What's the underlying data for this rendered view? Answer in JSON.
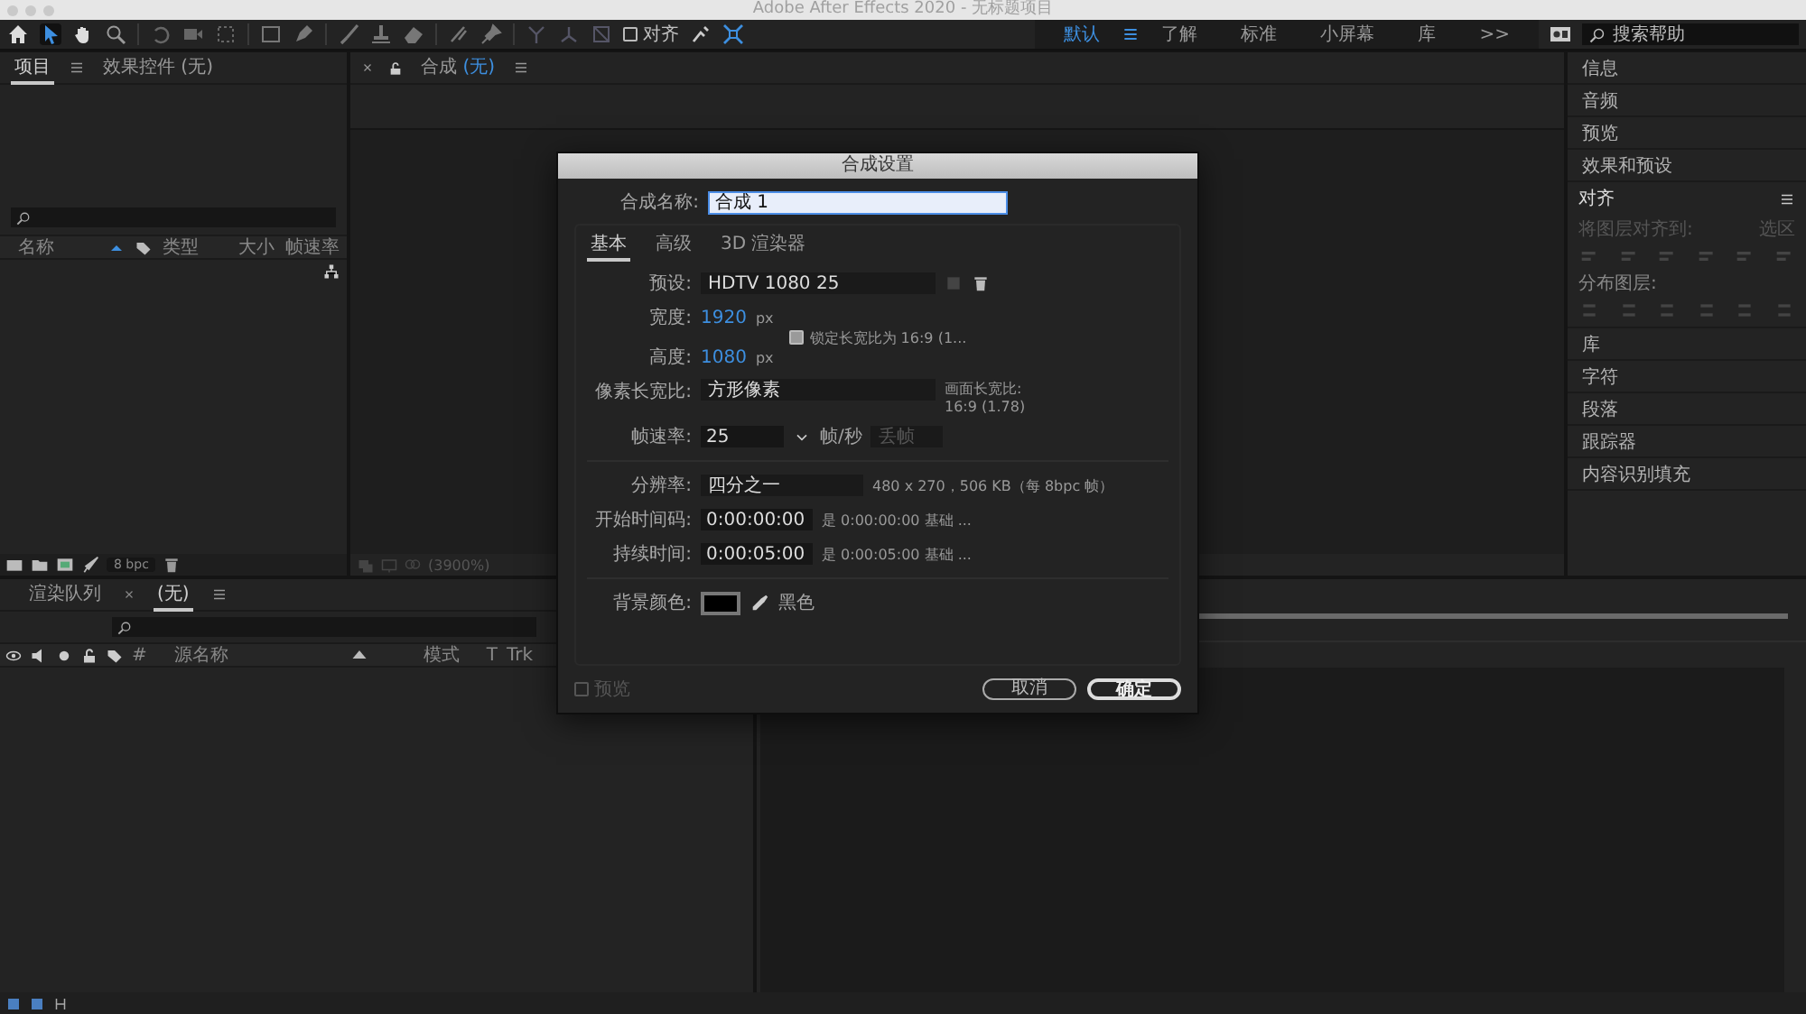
{
  "window": {
    "title": "Adobe After Effects 2020 - 无标题项目"
  },
  "toolbar": {
    "align_checkbox": {
      "label": "对齐",
      "checked": false
    }
  },
  "workspaces": [
    {
      "label": "默认",
      "selected": true
    },
    {
      "label": "了解",
      "selected": false
    },
    {
      "label": "标准",
      "selected": false
    },
    {
      "label": "小屏幕",
      "selected": false
    },
    {
      "label": "库",
      "selected": false
    }
  ],
  "workspace_overflow": ">>",
  "search_help": {
    "placeholder": "搜索帮助"
  },
  "project_panel": {
    "tabs": [
      {
        "label": "项目",
        "selected": true
      },
      {
        "label": "效果控件 (无)",
        "selected": false
      }
    ],
    "columns": [
      "名称",
      "类型",
      "大小",
      "帧速率"
    ],
    "bpc": "8 bpc"
  },
  "comp_panel": {
    "tab": "合成",
    "tab_value": "(无)",
    "zoom": "(3900%)"
  },
  "right_panels": {
    "top": [
      "信息",
      "音频",
      "预览",
      "效果和预设"
    ],
    "align": {
      "title": "对齐",
      "align_to_label": "将图层对齐到:",
      "align_to_value": "选区",
      "distribute_label": "分布图层:"
    },
    "bottom": [
      "库",
      "字符",
      "段落",
      "跟踪器",
      "内容识别填充"
    ]
  },
  "timeline": {
    "tabs": [
      {
        "label": "渲染队列",
        "selected": false
      },
      {
        "label": "(无)",
        "selected": true
      }
    ],
    "columns": [
      "#",
      "源名称",
      "模式",
      "T",
      "Trk"
    ]
  },
  "dialog": {
    "title": "合成设置",
    "name_label": "合成名称:",
    "name_value": "合成 1",
    "tabs": [
      {
        "label": "基本",
        "selected": true
      },
      {
        "label": "高级",
        "selected": false
      },
      {
        "label": "3D 渲染器",
        "selected": false
      }
    ],
    "preset_label": "预设:",
    "preset_value": "HDTV 1080 25",
    "width_label": "宽度:",
    "width_value": "1920",
    "width_unit": "px",
    "height_label": "高度:",
    "height_value": "1080",
    "height_unit": "px",
    "lock_aspect": {
      "label": "锁定长宽比为 16:9 (1...",
      "checked": true
    },
    "pixel_aspect_label": "像素长宽比:",
    "pixel_aspect_value": "方形像素",
    "frame_aspect_label": "画面长宽比:",
    "frame_aspect_value": "16:9 (1.78)",
    "frame_rate_label": "帧速率:",
    "frame_rate_value": "25",
    "frame_rate_unit": "帧/秒",
    "drop_frame": {
      "label": "丢帧",
      "disabled": true
    },
    "resolution_label": "分辨率:",
    "resolution_value": "四分之一",
    "resolution_info": "480 x 270，506 KB（每 8bpc 帧）",
    "start_label": "开始时间码:",
    "start_value": "0:00:00:00",
    "start_info": "是 0:00:00:00 基础 ...",
    "duration_label": "持续时间:",
    "duration_value": "0:00:05:00",
    "duration_info": "是 0:00:05:00 基础 ...",
    "background": {
      "label": "背景颜色:",
      "color": "#000000",
      "name": "黑色"
    },
    "preview": {
      "label": "预览",
      "checked": false
    },
    "cancel": "取消",
    "ok": "确定"
  }
}
